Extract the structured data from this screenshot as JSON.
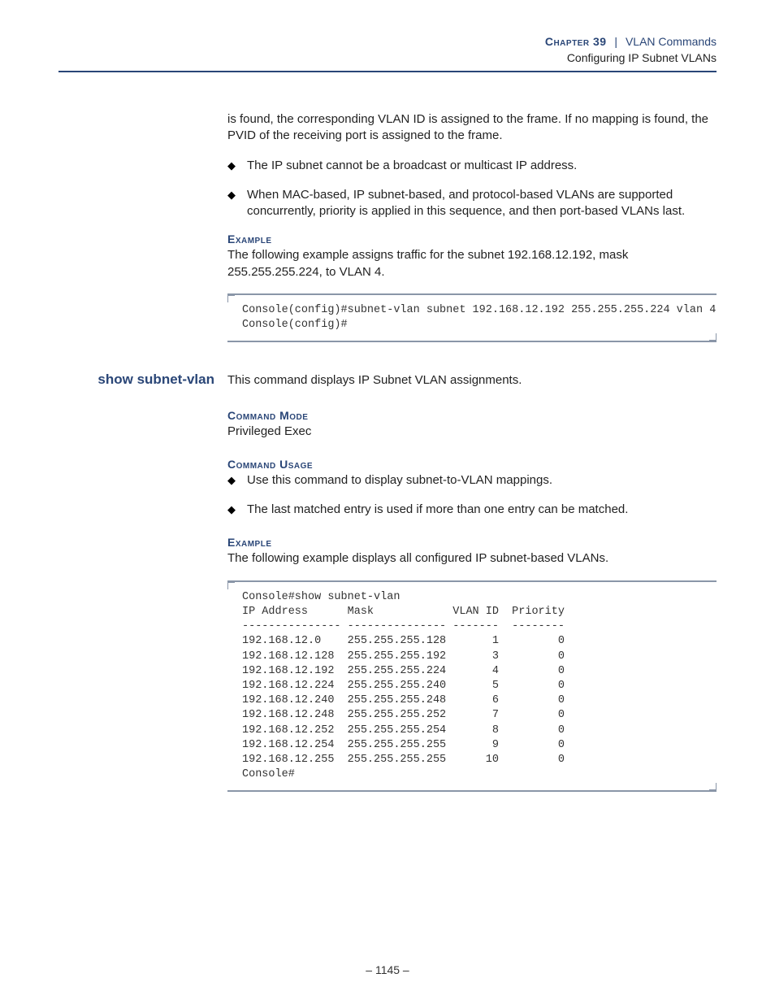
{
  "header": {
    "chapter_label": "Chapter 39",
    "chapter_title": "VLAN Commands",
    "subtitle": "Configuring IP Subnet VLANs"
  },
  "intro_paragraph": "is found, the corresponding VLAN ID is assigned to the frame. If no mapping is found, the PVID of the receiving port is assigned to the frame.",
  "intro_bullets": [
    "The IP subnet cannot be a broadcast or multicast IP address.",
    "When MAC-based, IP subnet-based, and protocol-based VLANs are supported concurrently, priority is applied in this sequence, and then port-based VLANs last."
  ],
  "example1": {
    "label": "Example",
    "desc": "The following example assigns traffic for the subnet 192.168.12.192, mask 255.255.255.224, to VLAN 4.",
    "code": "Console(config)#subnet-vlan subnet 192.168.12.192 255.255.255.224 vlan 4\nConsole(config)#"
  },
  "command": {
    "name": "show subnet-vlan",
    "desc": "This command displays IP Subnet VLAN assignments."
  },
  "command_mode": {
    "label": "Command Mode",
    "value": "Privileged Exec"
  },
  "command_usage": {
    "label": "Command Usage",
    "bullets": [
      "Use this command to display subnet-to-VLAN mappings.",
      "The last matched entry is used if more than one entry can be matched."
    ]
  },
  "example2": {
    "label": "Example",
    "desc": "The following example displays all configured IP subnet-based VLANs.",
    "code": "Console#show subnet-vlan\nIP Address      Mask            VLAN ID  Priority\n--------------- --------------- -------  --------\n192.168.12.0    255.255.255.128       1         0\n192.168.12.128  255.255.255.192       3         0\n192.168.12.192  255.255.255.224       4         0\n192.168.12.224  255.255.255.240       5         0\n192.168.12.240  255.255.255.248       6         0\n192.168.12.248  255.255.255.252       7         0\n192.168.12.252  255.255.255.254       8         0\n192.168.12.254  255.255.255.255       9         0\n192.168.12.255  255.255.255.255      10         0\nConsole#"
  },
  "page_number": "–  1145  –"
}
